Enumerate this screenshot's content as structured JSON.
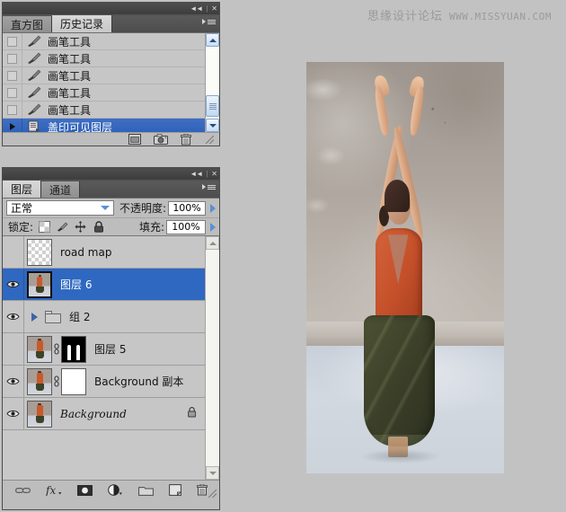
{
  "app": {
    "background_color": "#c2c2c2"
  },
  "watermark": {
    "chinese": "思缘设计论坛",
    "url": "WWW.MISSYUAN.COM"
  },
  "history_panel": {
    "titlebar": {
      "collapse_label": "◄◄",
      "separator": "|",
      "close_label": "✕"
    },
    "tabs": [
      {
        "label": "直方图",
        "active": false
      },
      {
        "label": "历史记录",
        "active": true
      }
    ],
    "items": [
      {
        "label": "画笔工具",
        "icon": "brush-icon",
        "selected": false
      },
      {
        "label": "画笔工具",
        "icon": "brush-icon",
        "selected": false
      },
      {
        "label": "画笔工具",
        "icon": "brush-icon",
        "selected": false
      },
      {
        "label": "画笔工具",
        "icon": "brush-icon",
        "selected": false
      },
      {
        "label": "画笔工具",
        "icon": "brush-icon",
        "selected": false
      },
      {
        "label": "盖印可见图层",
        "icon": "stamp-visible-layers-icon",
        "selected": true
      }
    ],
    "footer_icons": [
      "new-document-from-state-icon",
      "new-snapshot-icon",
      "delete-state-icon"
    ]
  },
  "layers_panel": {
    "titlebar": {
      "collapse_label": "◄◄",
      "separator": "|",
      "close_label": "✕"
    },
    "tabs": [
      {
        "label": "图层",
        "active": true
      },
      {
        "label": "通道",
        "active": false
      }
    ],
    "options": {
      "blend_mode": "正常",
      "opacity_label": "不透明度:",
      "opacity_value": "100%",
      "lock_label": "锁定:",
      "lock_icons": [
        "lock-transparent-pixels-icon",
        "lock-image-pixels-icon",
        "lock-position-icon",
        "lock-all-icon"
      ],
      "fill_label": "填充:",
      "fill_value": "100%"
    },
    "layers": [
      {
        "name": "road map",
        "visible": false,
        "selected": false,
        "thumb": "checker",
        "mask": null,
        "locked": false,
        "is_group": false
      },
      {
        "name": "图层 6",
        "visible": true,
        "selected": true,
        "thumb": "photo",
        "mask": null,
        "locked": false,
        "is_group": false
      },
      {
        "name": "组 2",
        "visible": true,
        "selected": false,
        "thumb": "folder",
        "mask": null,
        "locked": false,
        "is_group": true
      },
      {
        "name": "图层 5",
        "visible": false,
        "selected": false,
        "thumb": "photo",
        "mask": "black",
        "locked": false,
        "is_group": false
      },
      {
        "name": "Background 副本",
        "visible": true,
        "selected": false,
        "thumb": "photo",
        "mask": "white",
        "locked": false,
        "is_group": false
      },
      {
        "name": "Background",
        "visible": true,
        "selected": false,
        "thumb": "photo",
        "mask": null,
        "locked": true,
        "is_group": false
      }
    ],
    "footer_icons": [
      "link-layers-icon",
      "layer-style-fx-icon",
      "add-layer-mask-icon",
      "new-adjustment-layer-icon",
      "new-group-icon",
      "new-layer-icon",
      "delete-layer-icon"
    ]
  },
  "document_image": {
    "subject": "dancer-with-raised-arms",
    "top_color": "#c4502a",
    "skirt_color": "#3d4129",
    "wall_color": "#aba39b",
    "floor_color": "#d2d8e0"
  }
}
